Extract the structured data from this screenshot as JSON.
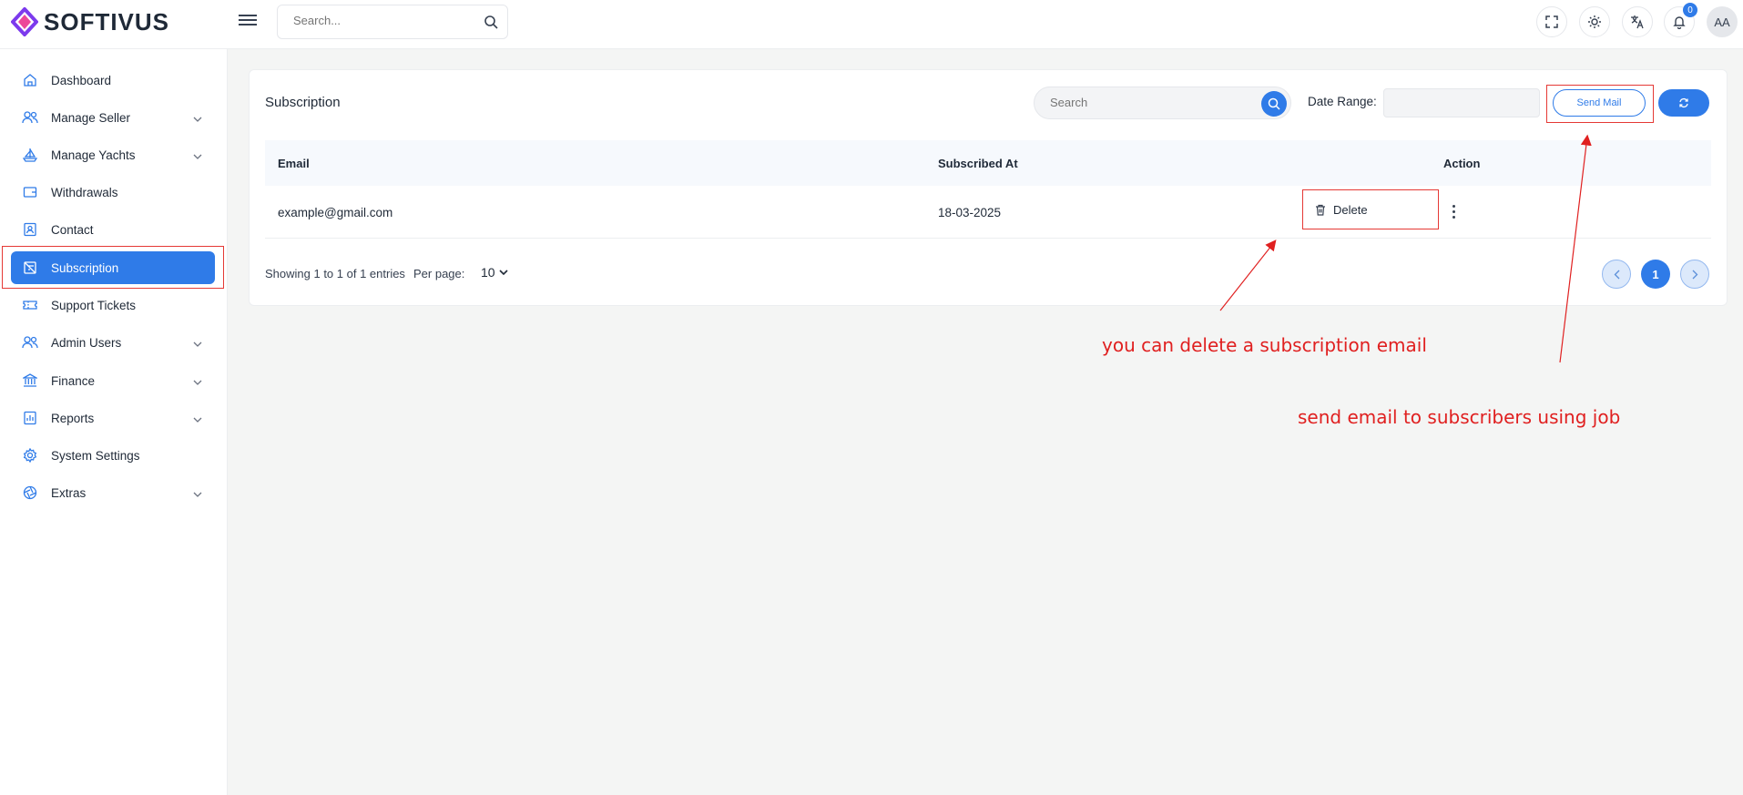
{
  "header": {
    "brand": "SOFTIVUS",
    "search_placeholder": "Search...",
    "notification_count": "0",
    "avatar_initials": "AA"
  },
  "sidebar": {
    "items": [
      {
        "label": "Dashboard",
        "icon": "home-icon"
      },
      {
        "label": "Manage Seller",
        "icon": "users-icon"
      },
      {
        "label": "Manage Yachts",
        "icon": "sailboat-icon"
      },
      {
        "label": "Withdrawals",
        "icon": "wallet-icon"
      },
      {
        "label": "Contact",
        "icon": "contact-icon"
      },
      {
        "label": "Subscription",
        "icon": "subscription-icon"
      },
      {
        "label": "Support Tickets",
        "icon": "ticket-icon"
      },
      {
        "label": "Admin Users",
        "icon": "users-icon"
      },
      {
        "label": "Finance",
        "icon": "bank-icon"
      },
      {
        "label": "Reports",
        "icon": "report-icon"
      },
      {
        "label": "System Settings",
        "icon": "gear-icon"
      },
      {
        "label": "Extras",
        "icon": "aperture-icon"
      }
    ],
    "active": "Subscription"
  },
  "main": {
    "title": "Subscription",
    "search_placeholder": "Search",
    "date_range_label": "Date Range:",
    "send_mail_label": "Send Mail",
    "table": {
      "headers": [
        "Email",
        "Subscribed At",
        "Action"
      ],
      "rows": [
        {
          "email": "example@gmail.com",
          "subscribed_at": "18-03-2025",
          "action_item": "Delete"
        }
      ]
    },
    "pagination": {
      "showing": "Showing 1 to 1 of 1 entries",
      "per_page_label": "Per page:",
      "per_page_value": "10",
      "current_page": "1"
    }
  },
  "annotations": {
    "delete_note": "you can delete a subscription email",
    "send_note": "send email to subscribers using job"
  },
  "colors": {
    "accent": "#2f7be8",
    "annotation": "#e02020"
  }
}
